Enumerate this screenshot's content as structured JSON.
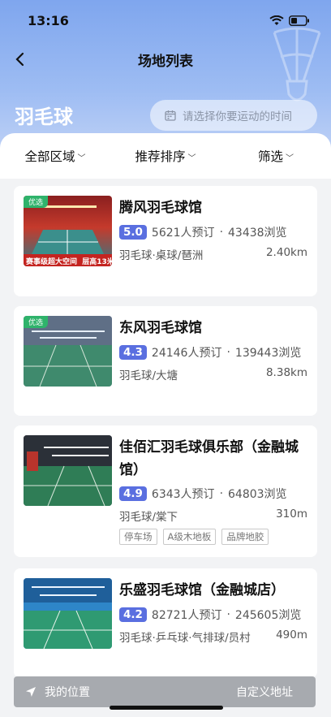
{
  "status_bar": {
    "time": "13:16"
  },
  "nav": {
    "title": "场地列表"
  },
  "header": {
    "sport": "羽毛球",
    "time_picker_placeholder": "请选择你要运动的时间"
  },
  "filters": [
    {
      "label": "全部区域"
    },
    {
      "label": "推荐排序"
    },
    {
      "label": "筛选"
    }
  ],
  "venues": [
    {
      "name": "腾风羽毛球馆",
      "tag": "优选",
      "rating": "5.0",
      "bookings": "5621人预订",
      "views": "43438浏览",
      "sports": "羽毛球·桌球/琶洲",
      "distance": "2.40km",
      "banner_left": "赛事级超大空间",
      "banner_right": "层高13米",
      "features": []
    },
    {
      "name": "东风羽毛球馆",
      "tag": "优选",
      "rating": "4.3",
      "bookings": "24146人预订",
      "views": "139443浏览",
      "sports": "羽毛球/大塘",
      "distance": "8.38km",
      "features": []
    },
    {
      "name": "佳佰汇羽毛球俱乐部（金融城馆）",
      "tag": "",
      "rating": "4.9",
      "bookings": "6343人预订",
      "views": "64803浏览",
      "sports": "羽毛球/棠下",
      "distance": "310m",
      "features": [
        "停车场",
        "A级木地板",
        "品牌地胶"
      ]
    },
    {
      "name": "乐盛羽毛球馆（金融城店）",
      "tag": "",
      "rating": "4.2",
      "bookings": "82721人预订",
      "views": "245605浏览",
      "sports": "羽毛球·乒乓球·气排球/员村",
      "distance": "490m",
      "features": []
    }
  ],
  "location_bar": {
    "my_location": "我的位置",
    "custom_address": "自定义地址"
  },
  "colors": {
    "hero_top": "#7fa6ee",
    "rating_badge": "#5a6fe0",
    "pick_tag": "#2fb36b",
    "location_bar": "#a7aaaf"
  }
}
